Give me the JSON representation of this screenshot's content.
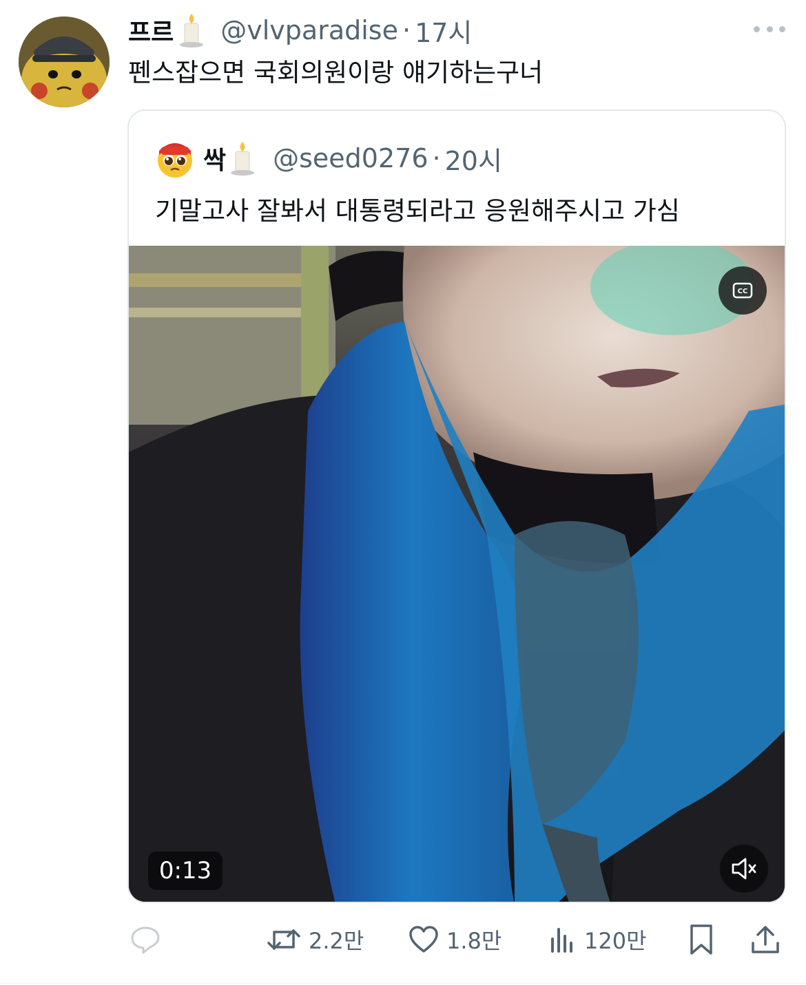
{
  "tweet": {
    "author": {
      "display_name": "프르",
      "name_emoji": "candle-emoji",
      "handle": "@vlvparadise",
      "separator": "·",
      "time": "17시",
      "avatar_icon": "pikachu-avatar"
    },
    "text": "펜스잡으면 국회의원이랑 얘기하는구너",
    "more_icon": "more-options-icon"
  },
  "quoted_tweet": {
    "author": {
      "display_name": "싹",
      "name_emoji": "candle-emoji",
      "handle": "@seed0276",
      "separator": "·",
      "time": "20시",
      "avatar_icon": "pleading-face-emoji"
    },
    "text": "기말고사 잘봐서 대통령되라고 응원해주시고 가심",
    "video": {
      "duration": "0:13",
      "cc_icon": "closed-captions-icon",
      "mute_icon": "muted-speaker-icon"
    }
  },
  "actions": {
    "reply": {
      "icon": "reply-icon",
      "count": ""
    },
    "retweet": {
      "icon": "retweet-icon",
      "count": "2.2만"
    },
    "like": {
      "icon": "heart-icon",
      "count": "1.8만"
    },
    "views": {
      "icon": "views-chart-icon",
      "count": "120만"
    },
    "bookmark": {
      "icon": "bookmark-icon"
    },
    "share": {
      "icon": "share-icon"
    }
  },
  "colors": {
    "text_primary": "#0f1419",
    "text_secondary": "#536471",
    "border": "#e4e8ea",
    "scarf_blue": "#1f6fb5"
  }
}
